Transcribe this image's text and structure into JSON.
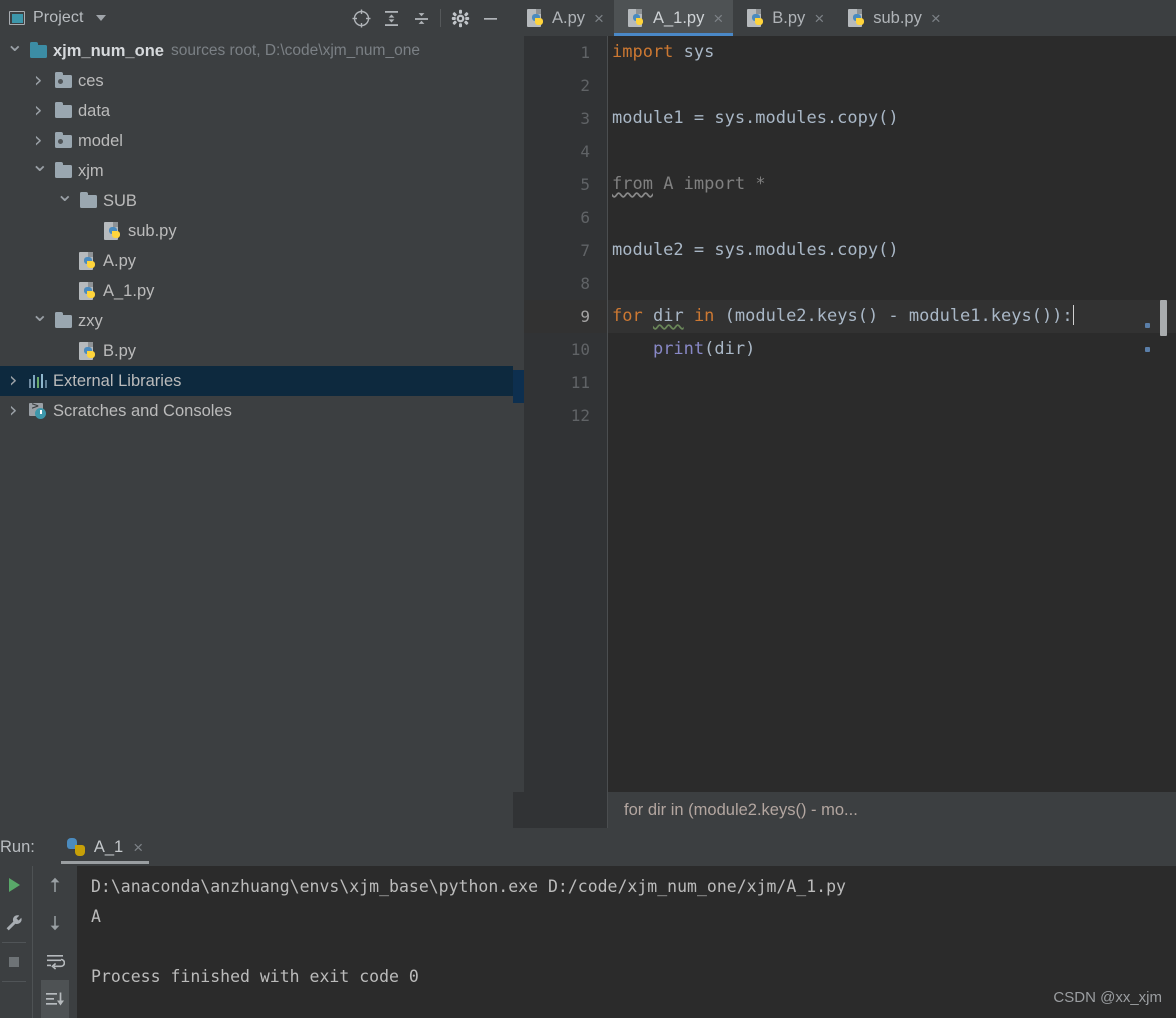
{
  "colors": {
    "panel_bg": "#3c3f41",
    "editor_bg": "#2b2b2b",
    "gutter_bg": "#313335",
    "tab_active_bg": "#4e5254",
    "tab_underline": "#4a88c7",
    "tree_selection": "#0d293e",
    "keyword": "#cc7832",
    "function": "#8888c6",
    "text": "#a9b7c6",
    "comment_gray": "#808080"
  },
  "project_panel": {
    "title": "Project",
    "window_icon": "window-icon",
    "dropdown_icon": "chevron-down-icon",
    "toolbar": [
      {
        "name": "select-opened-file-icon",
        "glyph": "target"
      },
      {
        "name": "expand-all-icon",
        "glyph": "expand"
      },
      {
        "name": "collapse-all-icon",
        "glyph": "collapse"
      },
      {
        "name": "settings-gear-icon",
        "glyph": "gear"
      },
      {
        "name": "hide-panel-icon",
        "glyph": "minus"
      }
    ]
  },
  "tree": {
    "items": [
      {
        "label": "xjm_num_one",
        "sub": "sources root,  D:\\code\\xjm_num_one",
        "indent": 0,
        "twisty": "open",
        "icon": "folder-teal",
        "bold": true,
        "selected": false
      },
      {
        "label": "ces",
        "sub": "",
        "indent": 1,
        "twisty": "closed",
        "icon": "folder-dot",
        "bold": false,
        "selected": false
      },
      {
        "label": "data",
        "sub": "",
        "indent": 1,
        "twisty": "closed",
        "icon": "folder",
        "bold": false,
        "selected": false
      },
      {
        "label": "model",
        "sub": "",
        "indent": 1,
        "twisty": "closed",
        "icon": "folder-dot",
        "bold": false,
        "selected": false
      },
      {
        "label": "xjm",
        "sub": "",
        "indent": 1,
        "twisty": "open",
        "icon": "folder",
        "bold": false,
        "selected": false
      },
      {
        "label": "SUB",
        "sub": "",
        "indent": 2,
        "twisty": "open",
        "icon": "folder",
        "bold": false,
        "selected": false
      },
      {
        "label": "sub.py",
        "sub": "",
        "indent": 3,
        "twisty": "none",
        "icon": "python-file",
        "bold": false,
        "selected": false
      },
      {
        "label": "A.py",
        "sub": "",
        "indent": 2,
        "twisty": "none",
        "icon": "python-file",
        "bold": false,
        "selected": false
      },
      {
        "label": "A_1.py",
        "sub": "",
        "indent": 2,
        "twisty": "none",
        "icon": "python-file",
        "bold": false,
        "selected": false
      },
      {
        "label": "zxy",
        "sub": "",
        "indent": 1,
        "twisty": "open",
        "icon": "folder",
        "bold": false,
        "selected": false
      },
      {
        "label": "B.py",
        "sub": "",
        "indent": 2,
        "twisty": "none",
        "icon": "python-file",
        "bold": false,
        "selected": false
      },
      {
        "label": "External Libraries",
        "sub": "",
        "indent": 0,
        "twisty": "closed",
        "icon": "libraries",
        "bold": false,
        "selected": true
      },
      {
        "label": "Scratches and Consoles",
        "sub": "",
        "indent": 0,
        "twisty": "closed",
        "icon": "scratches",
        "bold": false,
        "selected": false
      }
    ]
  },
  "editor": {
    "tabs": [
      {
        "label": "A.py",
        "active": false,
        "close": "×"
      },
      {
        "label": "A_1.py",
        "active": true,
        "close": "×"
      },
      {
        "label": "B.py",
        "active": false,
        "close": "×"
      },
      {
        "label": "sub.py",
        "active": false,
        "close": "×"
      }
    ],
    "line_numbers": [
      "1",
      "2",
      "3",
      "4",
      "5",
      "6",
      "7",
      "8",
      "9",
      "10",
      "11",
      "12"
    ],
    "current_line": 9,
    "code_lines": [
      {
        "n": 1,
        "text": "import sys"
      },
      {
        "n": 2,
        "text": ""
      },
      {
        "n": 3,
        "text": "module1 = sys.modules.copy()"
      },
      {
        "n": 4,
        "text": ""
      },
      {
        "n": 5,
        "text": "from A import *"
      },
      {
        "n": 6,
        "text": ""
      },
      {
        "n": 7,
        "text": "module2 = sys.modules.copy()"
      },
      {
        "n": 8,
        "text": ""
      },
      {
        "n": 9,
        "text": "for dir in (module2.keys() - module1.keys()):"
      },
      {
        "n": 10,
        "text": "    print(dir)"
      },
      {
        "n": 11,
        "text": ""
      },
      {
        "n": 12,
        "text": ""
      }
    ],
    "breadcrumb": "for dir in (module2.keys() - mo..."
  },
  "run_panel": {
    "label": "Run:",
    "tab_name": "A_1",
    "tab_close": "×",
    "side_buttons": [
      {
        "name": "rerun-button",
        "glyph": "play"
      },
      {
        "name": "edit-configurations-button",
        "glyph": "wrench"
      },
      {
        "name": "stop-button",
        "glyph": "square"
      },
      {
        "name": "up-the-stack-button",
        "glyph": "arrow-up"
      },
      {
        "name": "down-the-stack-button",
        "glyph": "arrow-down"
      },
      {
        "name": "soft-wrap-button",
        "glyph": "wrap"
      },
      {
        "name": "scroll-to-end-button",
        "glyph": "scroll-end"
      }
    ],
    "console": {
      "line1": "D:\\anaconda\\anzhuang\\envs\\xjm_base\\python.exe D:/code/xjm_num_one/xjm/A_1.py",
      "line2": "A",
      "line3": "",
      "line4": "Process finished with exit code 0"
    }
  },
  "watermark": "CSDN @xx_xjm"
}
